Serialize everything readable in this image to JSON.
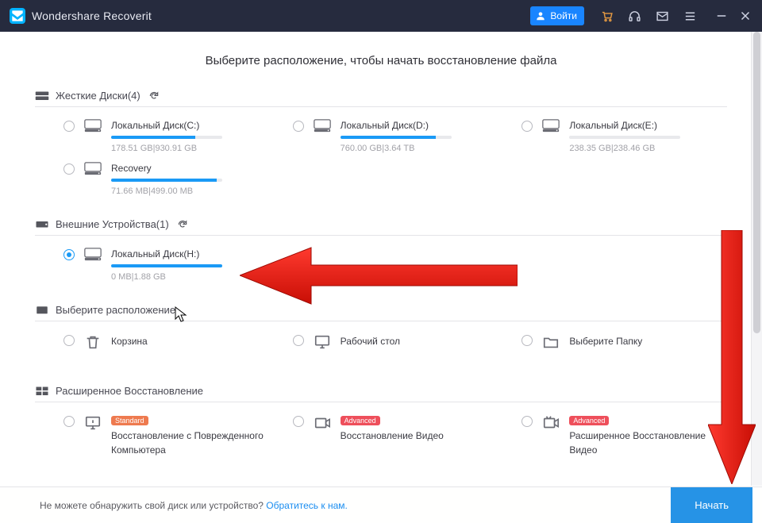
{
  "app": {
    "title": "Wondershare Recoverit",
    "login_label": "Войти"
  },
  "heading": "Выберите расположение, чтобы начать восстановление файла",
  "sections": {
    "hdd": {
      "title": "Жесткие Диски(4)"
    },
    "ext": {
      "title": "Внешние Устройства(1)"
    },
    "loc": {
      "title": "Выберите расположение"
    },
    "adv": {
      "title": "Расширенное Восстановление"
    }
  },
  "hdd_items": [
    {
      "name": "Локальный Диск(C:)",
      "stats": "178.51 GB|930.91 GB",
      "pct": 76
    },
    {
      "name": "Локальный Диск(D:)",
      "stats": "760.00 GB|3.64 TB",
      "pct": 86
    },
    {
      "name": "Локальный Диск(E:)",
      "stats": "238.35 GB|238.46 GB",
      "pct": 0
    },
    {
      "name": "Recovery",
      "stats": "71.66 MB|499.00 MB",
      "pct": 95
    }
  ],
  "ext_items": [
    {
      "name": "Локальный Диск(H:)",
      "stats": "0 MB|1.88 GB",
      "pct": 100
    }
  ],
  "loc_items": [
    {
      "name": "Корзина"
    },
    {
      "name": "Рабочий стол"
    },
    {
      "name": "Выберите Папку"
    }
  ],
  "adv_items": [
    {
      "name": "Восстановление с Поврежденного Компьютера",
      "badge": "Standard",
      "badge_cls": "std"
    },
    {
      "name": "Восстановление Видео",
      "badge": "Advanced",
      "badge_cls": "adv"
    },
    {
      "name": "Расширенное Восстановление Видео",
      "badge": "Advanced",
      "badge_cls": "adv"
    }
  ],
  "footer": {
    "hint_text": "Не можете обнаружить свой диск или устройство? ",
    "hint_link": "Обратитесь к нам.",
    "start_label": "Начать"
  }
}
